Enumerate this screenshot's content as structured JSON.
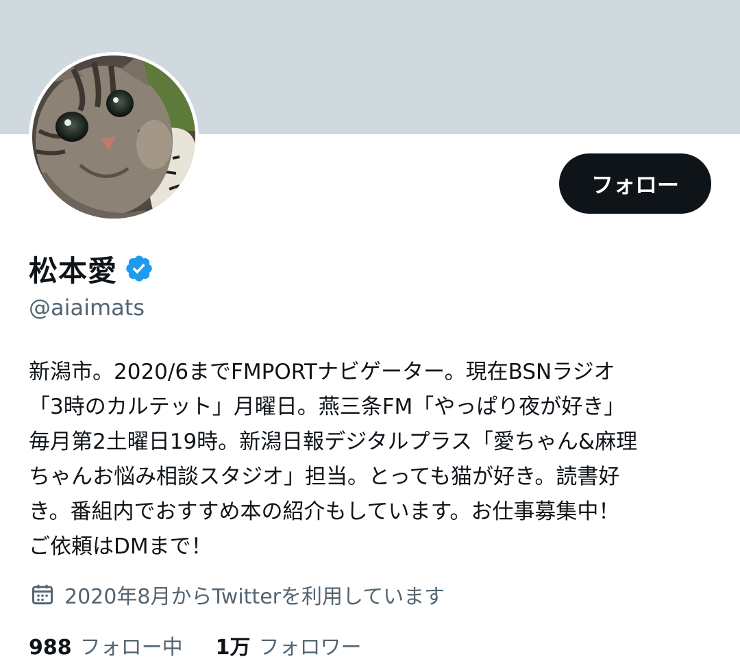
{
  "profile": {
    "display_name": "松本愛",
    "handle": "@aiaimats",
    "follow_label": "フォロー",
    "bio_lines": [
      "新潟市。2020/6までFMPORTナビゲーター。現在BSNラジオ",
      "「3時のカルテット」月曜日。燕三条FM「やっぱり夜が好き」",
      "毎月第2土曜日19時。新潟日報デジタルプラス「愛ちゃん&麻理",
      "ちゃんお悩み相談スタジオ」担当。とっても猫が好き。読書好",
      "き。番組内でおすすめ本の紹介もしています。お仕事募集中！",
      "ご依頼はDMまで！"
    ],
    "joined": "2020年8月からTwitterを利用しています",
    "following_count": "988",
    "following_label": "フォロー中",
    "followers_count": "1万",
    "followers_label": "フォロワー"
  },
  "icons": {
    "verified": "verified-badge-icon",
    "calendar": "calendar-icon"
  },
  "colors": {
    "banner": "#cfd9de",
    "button": "#0f1419",
    "verified": "#1d9bf0",
    "secondary_text": "#536471",
    "primary_text": "#0f1419"
  }
}
